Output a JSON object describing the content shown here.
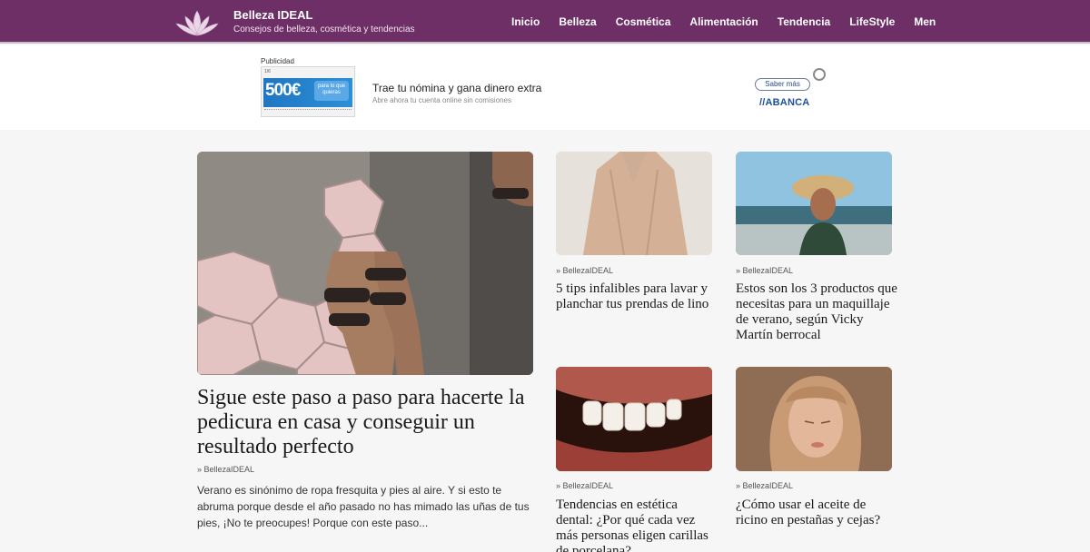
{
  "header": {
    "title": "Belleza IDEAL",
    "subtitle": "Consejos de belleza, cosmética y tendencias",
    "nav": [
      "Inicio",
      "Belleza",
      "Cosmética",
      "Alimentación",
      "Tendencia",
      "LifeStyle",
      "Men"
    ]
  },
  "ad": {
    "label": "Publicidad",
    "thumb_amount": "500€",
    "thumb_tag": "para lo que quieras",
    "thumb_mini": "1/6",
    "headline": "Trae tu nómina y gana dinero extra",
    "sub": "Abre ahora tu cuenta online sin comisiones",
    "cta": "Saber más",
    "brand": "//ABANCA"
  },
  "articles": [
    {
      "category": "» BellezaIDEAL",
      "title": "Sigue este paso a paso para hacerte la pedicura en casa y conseguir un resultado perfecto",
      "excerpt": "Verano es sinónimo de ropa fresquita y pies al aire. Y si esto te abruma porque desde el año pasado no has mimado las uñas de tus pies, ¡No te preocupes! Porque con este paso..."
    },
    {
      "category": "» BellezaIDEAL",
      "title": "5 tips infalibles para lavar y planchar tus prendas de lino"
    },
    {
      "category": "» BellezaIDEAL",
      "title": "Estos son los 3 productos que necesitas para un maquillaje de verano, según Vicky Martín berrocal"
    },
    {
      "category": "» BellezaIDEAL",
      "title": "Tendencias en estética dental: ¿Por qué cada vez más personas eligen carillas de porcelana?"
    },
    {
      "category": "» BellezaIDEAL",
      "title": "¿Cómo usar el aceite de ricino en pestañas y cejas?"
    }
  ]
}
